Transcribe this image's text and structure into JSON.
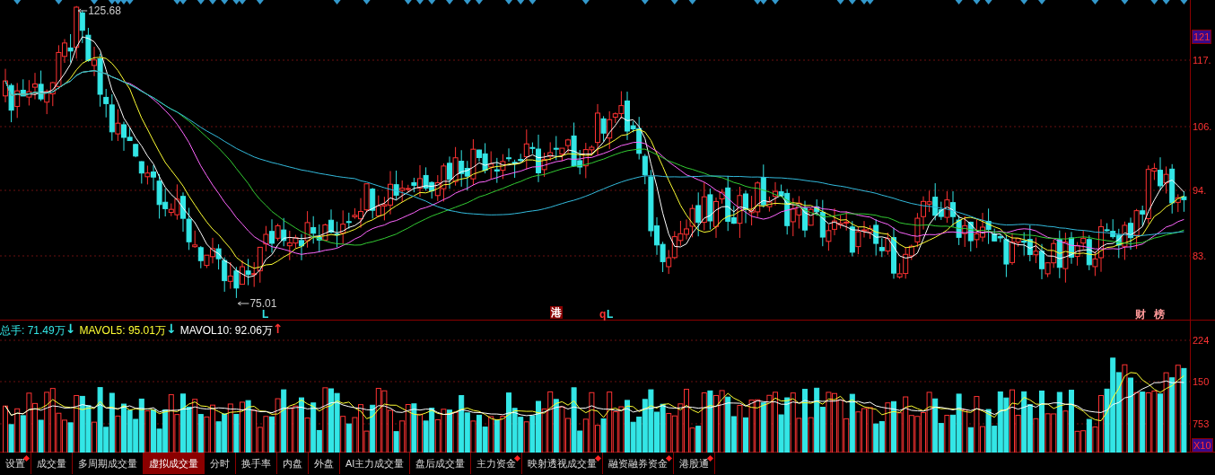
{
  "price_panel": {
    "high_label": "125.68",
    "low_label": "75.01",
    "markers": [
      {
        "text": "L",
        "kind": "plain",
        "color": "#33e6e6"
      },
      {
        "text": "港",
        "kind": "boxed",
        "color": "#8b0000"
      },
      {
        "text": "q",
        "kind": "plain",
        "color": "#ff3333"
      },
      {
        "text": "L",
        "kind": "plain",
        "color": "#33e6e6"
      },
      {
        "text": "财",
        "kind": "plain",
        "color": "#ff9999"
      },
      {
        "text": "榜",
        "kind": "plain",
        "color": "#ff9999"
      }
    ],
    "axis_labels": [
      {
        "text": "121",
        "selected": true
      },
      {
        "text": "117.",
        "selected": false
      },
      {
        "text": "106.",
        "selected": false
      },
      {
        "text": "94.",
        "selected": false
      },
      {
        "text": "83.",
        "selected": false
      }
    ]
  },
  "volume_panel": {
    "legend": [
      {
        "text": "总手: 71.49万",
        "color": "#33e6e6",
        "arrow": {
          "text": "↓",
          "color": "#33e6e6"
        }
      },
      {
        "text": "MAVOL5: 95.01万",
        "color": "#ffff33",
        "arrow": {
          "text": "↓",
          "color": "#33e6e6"
        }
      },
      {
        "text": "MAVOL10: 92.06万",
        "color": "#ffffff",
        "arrow": {
          "text": "↑",
          "color": "#ff3333"
        }
      }
    ],
    "axis_labels": [
      {
        "text": "224",
        "selected": false
      },
      {
        "text": "150",
        "selected": false
      },
      {
        "text": "753",
        "selected": false
      },
      {
        "text": "X10",
        "selected": true
      }
    ]
  },
  "tabs": [
    {
      "label": "设置",
      "selected": false,
      "dot": true
    },
    {
      "label": "成交量",
      "selected": false,
      "dot": false
    },
    {
      "label": "多周期成交量",
      "selected": false,
      "dot": false
    },
    {
      "label": "虚拟成交量",
      "selected": true,
      "dot": false
    },
    {
      "label": "分时",
      "selected": false,
      "dot": false
    },
    {
      "label": "换手率",
      "selected": false,
      "dot": false
    },
    {
      "label": "内盘",
      "selected": false,
      "dot": false
    },
    {
      "label": "外盘",
      "selected": false,
      "dot": false
    },
    {
      "label": "AI主力成交量",
      "selected": false,
      "dot": false
    },
    {
      "label": "盘后成交量",
      "selected": false,
      "dot": false
    },
    {
      "label": "主力资金",
      "selected": false,
      "dot": true
    },
    {
      "label": "映射透视成交量",
      "selected": false,
      "dot": true
    },
    {
      "label": "融资融券资金",
      "selected": false,
      "dot": true
    },
    {
      "label": "港股通",
      "selected": false,
      "dot": true
    }
  ]
}
